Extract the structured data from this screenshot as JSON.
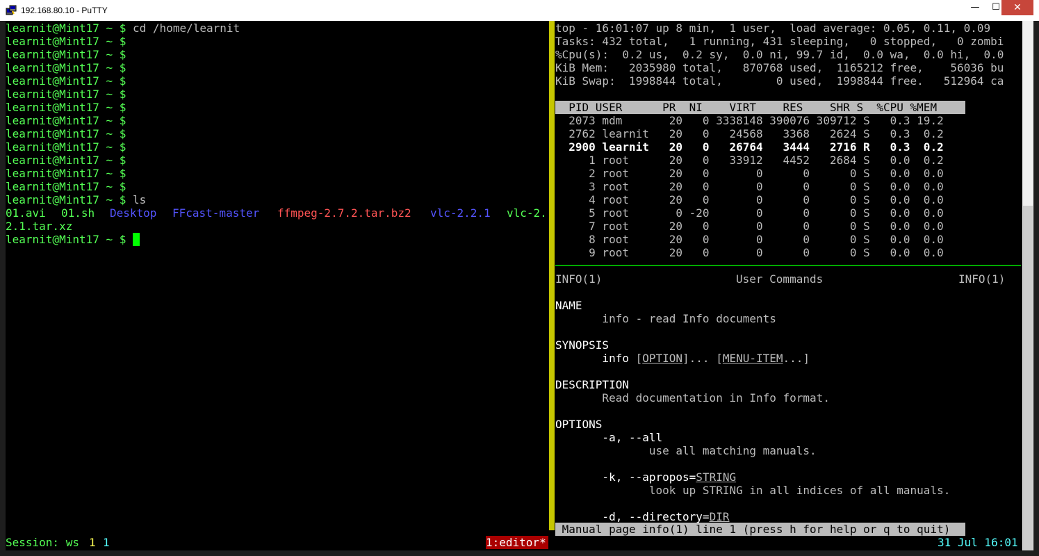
{
  "window": {
    "title": "192.168.80.10 - PuTTY",
    "icon": "putty-icon",
    "buttons": {
      "minimize": "—",
      "maximize": "☐",
      "close": "✕"
    }
  },
  "left_pane": {
    "prompt": "learnit@Mint17 ~ $",
    "cmd_cd": " cd /home/learnit",
    "cmd_ls": " ls",
    "ls_entries": [
      {
        "name": "01.avi",
        "kind": "file"
      },
      {
        "name": "01.sh",
        "kind": "file"
      },
      {
        "name": "Desktop",
        "kind": "dir"
      },
      {
        "name": "FFcast-master",
        "kind": "dir"
      },
      {
        "name": "ffmpeg-2.7.2.tar.bz2",
        "kind": "archive"
      },
      {
        "name": "vlc-2.2.1",
        "kind": "dir"
      },
      {
        "name": "vlc-2.",
        "kind": "archive"
      }
    ],
    "ls_wrap": "2.1.tar.xz"
  },
  "top": {
    "line1": "top - 16:01:07 up 8 min,  1 user,  load average: 0.05, 0.11, 0.09",
    "line2": "Tasks: 432 total,   1 running, 431 sleeping,   0 stopped,   0 zombi",
    "line3": "%Cpu(s):  0.2 us,  0.2 sy,  0.0 ni, 99.7 id,  0.0 wa,  0.0 hi,  0.0",
    "line4": "KiB Mem:   2035980 total,   870768 used,  1165212 free,    56036 bu",
    "line5": "KiB Swap:  1998844 total,        0 used,  1998844 free.   512964 ca",
    "header": "  PID USER      PR  NI    VIRT    RES    SHR S  %CPU %MEM",
    "rows": [
      "  2073 mdm       20   0 3338148 390076 309712 S   0.3 19.2",
      "  2762 learnit   20   0   24568   3368   2624 S   0.3  0.2",
      "  2900 learnit   20   0   26764   3444   2716 R   0.3  0.2",
      "     1 root      20   0   33912   4452   2684 S   0.0  0.2",
      "     2 root      20   0       0      0      0 S   0.0  0.0",
      "     3 root      20   0       0      0      0 S   0.0  0.0",
      "     4 root      20   0       0      0      0 S   0.0  0.0",
      "     5 root       0 -20       0      0      0 S   0.0  0.0",
      "     7 root      20   0       0      0      0 S   0.0  0.0",
      "     8 root      20   0       0      0      0 S   0.0  0.0",
      "     9 root      20   0       0      0      0 S   0.0  0.0"
    ]
  },
  "man": {
    "head_left": "INFO(1)",
    "head_center": "User Commands",
    "head_right": "INFO(1)",
    "name_h": "NAME",
    "name_t": "       info - read Info documents",
    "syn_h": "SYNOPSIS",
    "syn_info": "       info ",
    "syn_b1": "[",
    "syn_opt": "OPTION",
    "syn_b2": "]... [",
    "syn_menu": "MENU-ITEM",
    "syn_b3": "...]",
    "desc_h": "DESCRIPTION",
    "desc_t": "       Read documentation in Info format.",
    "opt_h": "OPTIONS",
    "opt_a": "       -a, --all",
    "opt_a_d": "              use all matching manuals.",
    "opt_k": "       -k, --apropos=",
    "opt_k_arg": "STRING",
    "opt_k_d": "              look up STRING in all indices of all manuals.",
    "opt_d": "       -d, --directory=",
    "opt_d_arg": "DIR",
    "status": " Manual page info(1) line 1 (press h for help or q to quit)"
  },
  "tmux": {
    "session": "Session: ws",
    "n1": "1",
    "n2": "1",
    "window_tag": "1:editor*",
    "clock": "31 Jul 16:01"
  },
  "colors": {
    "prompt": "#54ff54",
    "dir": "#5454ff",
    "archive": "#ff5454",
    "separator": "#c6c600",
    "cursor": "#00ff00",
    "window_tag_bg": "#aa0000"
  }
}
